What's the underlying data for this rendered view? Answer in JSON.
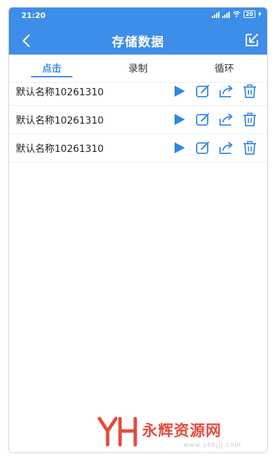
{
  "status_bar": {
    "time": "21:20",
    "battery": "20"
  },
  "header": {
    "title": "存储数据"
  },
  "tabs": [
    {
      "label": "点击",
      "active": true
    },
    {
      "label": "录制",
      "active": false
    },
    {
      "label": "循环",
      "active": false
    }
  ],
  "records": [
    {
      "name": "默认名称10261310"
    },
    {
      "name": "默认名称10261310"
    },
    {
      "name": "默认名称10261310"
    }
  ],
  "watermark": {
    "text": "永辉资源网",
    "url": "www.yhkjjj.com"
  },
  "colors": {
    "primary": "#3d8ee8",
    "watermark": "#e84a3c"
  },
  "icons": {
    "back": "chevron-left-icon",
    "export": "export-icon",
    "play": "play-icon",
    "edit": "edit-icon",
    "share": "share-icon",
    "delete": "trash-icon"
  }
}
